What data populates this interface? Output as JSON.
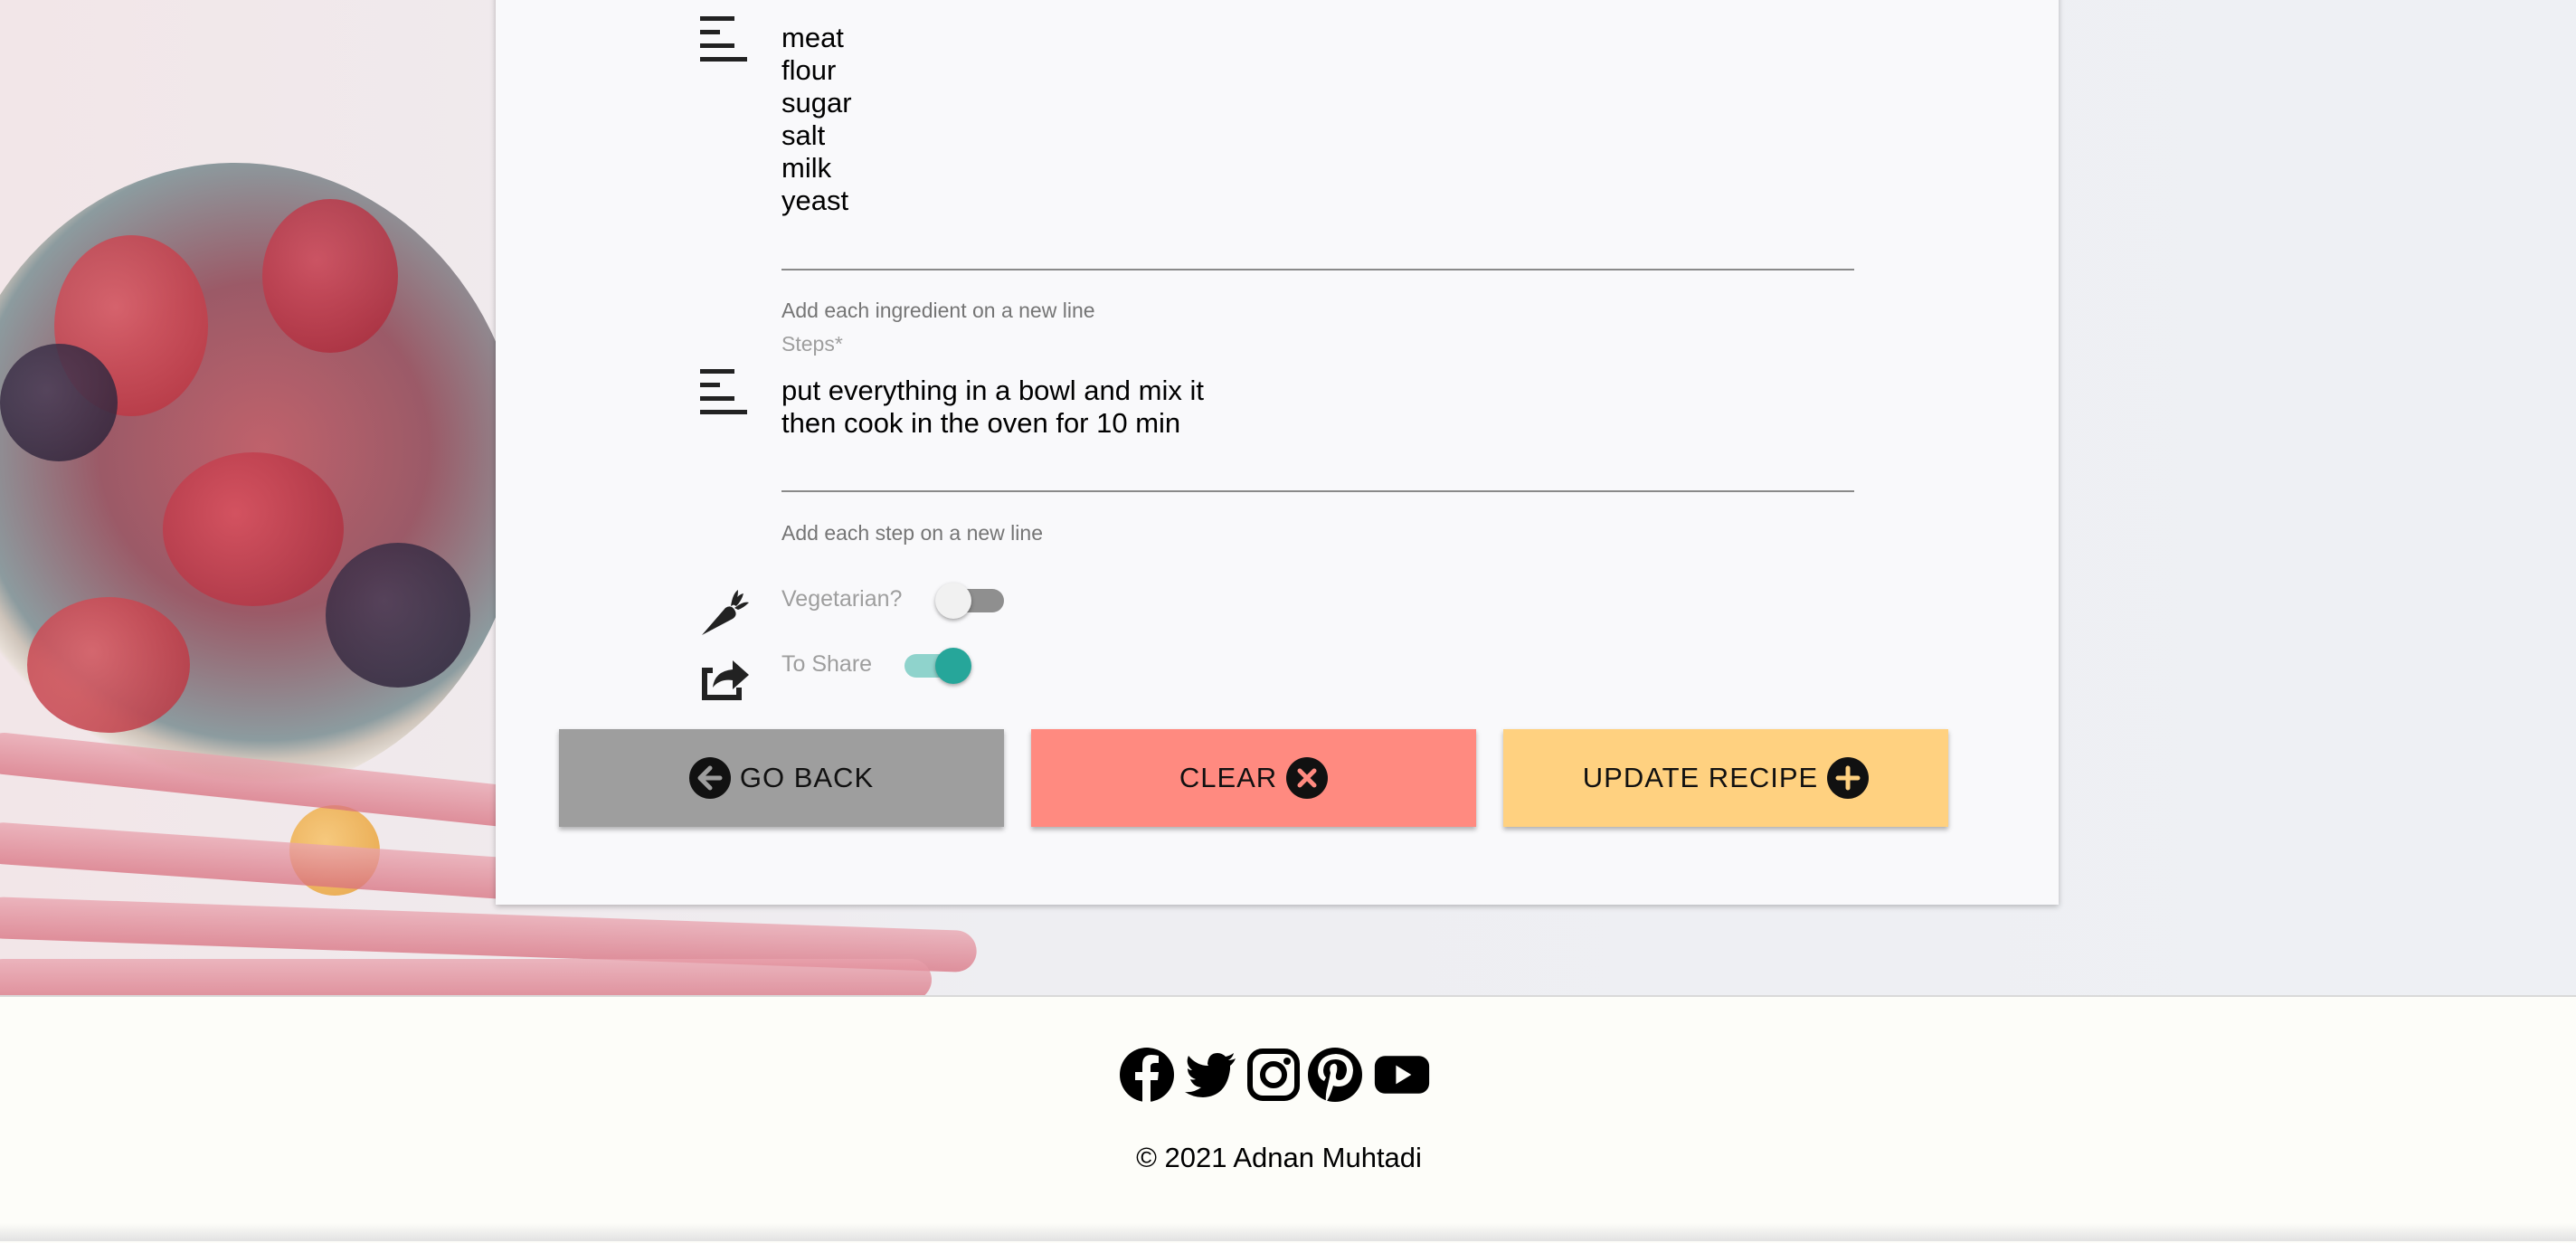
{
  "form": {
    "ingredients": {
      "lines": [
        "meat",
        "flour",
        "sugar",
        "salt",
        "milk",
        "yeast"
      ],
      "helper": "Add each ingredient on a new line"
    },
    "steps": {
      "label": "Steps*",
      "lines": [
        "put everything in a bowl and mix it",
        "then cook in the oven for 10 min"
      ],
      "helper": "Add each step on a new line"
    },
    "vegetarian": {
      "label": "Vegetarian?",
      "checked": false
    },
    "to_share": {
      "label": "To Share",
      "checked": true
    }
  },
  "buttons": {
    "go_back": "GO BACK",
    "clear": "CLEAR",
    "update": "UPDATE RECIPE"
  },
  "colors": {
    "go_back": "#9e9e9e",
    "clear": "#ff8a80",
    "update": "#ffd180",
    "switch_on": "#26a69a"
  },
  "footer": {
    "social_icons": [
      "facebook-icon",
      "twitter-icon",
      "instagram-icon",
      "pinterest-icon",
      "youtube-icon"
    ],
    "copyright": "© 2021 Adnan Muhtadi"
  }
}
